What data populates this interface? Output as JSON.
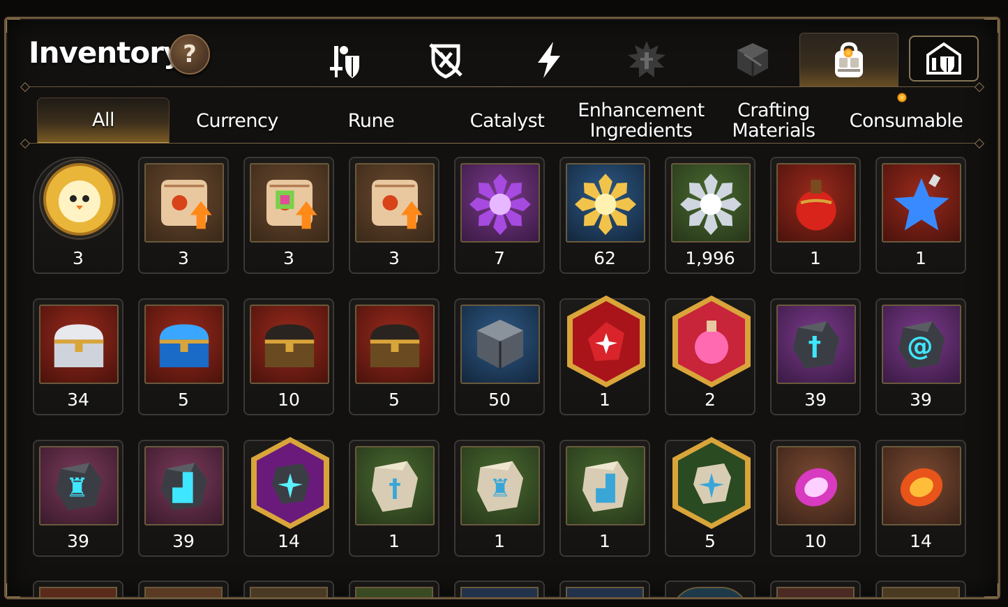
{
  "header": {
    "title": "Inventory",
    "help_label": "?"
  },
  "category_buttons": [
    {
      "name": "equipment-icon",
      "selected": false
    },
    {
      "name": "no-defense-icon",
      "selected": false
    },
    {
      "name": "lightning-icon",
      "selected": false
    },
    {
      "name": "spiky-emblem-icon",
      "selected": false
    },
    {
      "name": "cube-icon",
      "selected": false
    },
    {
      "name": "backpack-icon",
      "selected": true,
      "notification": true
    },
    {
      "name": "storage-shield-icon",
      "selected": false
    }
  ],
  "tabs": [
    {
      "label": "All",
      "selected": true
    },
    {
      "label": "Currency",
      "selected": false
    },
    {
      "label": "Rune",
      "selected": false
    },
    {
      "label": "Catalyst",
      "selected": false
    },
    {
      "label": "Enhancement Ingredients",
      "selected": false
    },
    {
      "label": "Crafting Materials",
      "selected": false
    },
    {
      "label": "Consumable",
      "selected": false,
      "notification": true
    }
  ],
  "items": [
    {
      "name": "chick-medal-item",
      "qty": "3"
    },
    {
      "name": "scroll-upgrade-item",
      "qty": "3"
    },
    {
      "name": "rainbow-scroll-upgrade-item",
      "qty": "3"
    },
    {
      "name": "scroll-upgrade-item",
      "qty": "3"
    },
    {
      "name": "purple-crystal-flower-item",
      "qty": "7"
    },
    {
      "name": "gold-crystal-flower-item",
      "qty": "62"
    },
    {
      "name": "silver-crystal-flower-item",
      "qty": "1,996"
    },
    {
      "name": "red-potion-item",
      "qty": "1"
    },
    {
      "name": "blue-star-potion-item",
      "qty": "1"
    },
    {
      "name": "silver-chest-item",
      "qty": "34"
    },
    {
      "name": "blue-chest-item",
      "qty": "5"
    },
    {
      "name": "gold-chest-item",
      "qty": "10"
    },
    {
      "name": "gold-chest-item",
      "qty": "5"
    },
    {
      "name": "iron-cube-item",
      "qty": "50"
    },
    {
      "name": "red-stone-hex-item",
      "qty": "1"
    },
    {
      "name": "pink-potion-hex-item",
      "qty": "2"
    },
    {
      "name": "sword-rune-stone-item",
      "qty": "39"
    },
    {
      "name": "swirl-rune-stone-item",
      "qty": "39"
    },
    {
      "name": "armor-rune-stone-item",
      "qty": "39"
    },
    {
      "name": "boot-rune-stone-item",
      "qty": "39"
    },
    {
      "name": "star-rune-hex-item",
      "qty": "14"
    },
    {
      "name": "sword-tablet-item",
      "qty": "1"
    },
    {
      "name": "armor-tablet-item",
      "qty": "1"
    },
    {
      "name": "boot-tablet-item",
      "qty": "1"
    },
    {
      "name": "star-tablet-hex-item",
      "qty": "5"
    },
    {
      "name": "purple-gem-item",
      "qty": "10"
    },
    {
      "name": "orange-gem-item",
      "qty": "14"
    }
  ],
  "colors": {
    "frame": "#6e5a3e",
    "accent_gold": "#c89b45",
    "notification": "#ff9a10"
  }
}
